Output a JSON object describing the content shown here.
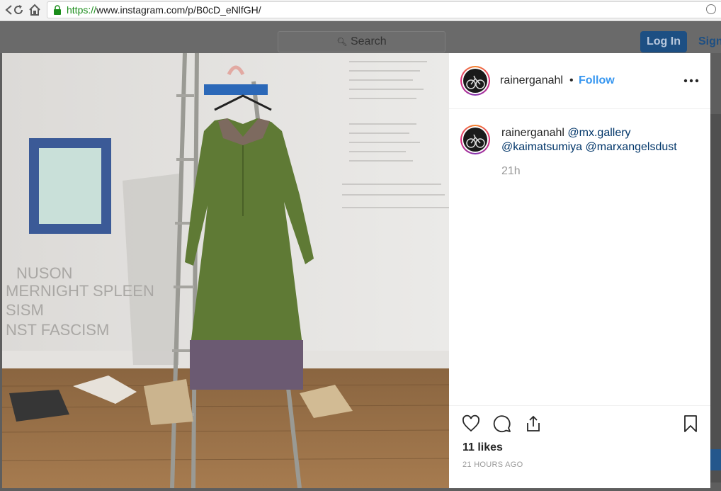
{
  "browser": {
    "url_scheme": "https://",
    "url_rest": "www.instagram.com/p/B0cD_eNlfGH/"
  },
  "background_page": {
    "search_placeholder": "Search",
    "login_label": "Log In",
    "signup_label": "Sign"
  },
  "post": {
    "header": {
      "username": "rainerganahl",
      "separator": "•",
      "follow_label": "Follow"
    },
    "caption": {
      "username": "rainerganahl",
      "mentions": [
        "@mx.gallery",
        "@kaimatsumiya",
        "@marxangelsdust"
      ]
    },
    "caption_time": "21h",
    "likes": "11 likes",
    "timestamp": "21 HOURS AGO",
    "photo": {
      "wall_text": [
        "NUSON",
        "MERNIGHT SPLEEN",
        "SISM",
        "NST FASCISM"
      ]
    }
  },
  "colors": {
    "follow": "#3897f0",
    "mention": "#003569",
    "login": "#1d4f83"
  },
  "icons": [
    "back-icon",
    "reload-icon",
    "home-icon",
    "lock-icon",
    "more-icon",
    "heart-icon",
    "comment-icon",
    "share-icon",
    "bookmark-icon"
  ]
}
